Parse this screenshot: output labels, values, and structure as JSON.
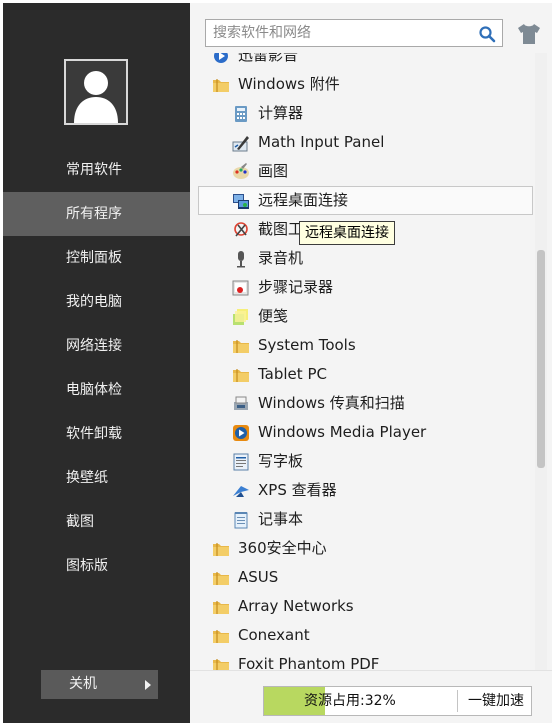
{
  "sidebar": {
    "items": [
      {
        "label": "常用软件"
      },
      {
        "label": "所有程序"
      },
      {
        "label": "控制面板"
      },
      {
        "label": "我的电脑"
      },
      {
        "label": "网络连接"
      },
      {
        "label": "电脑体检"
      },
      {
        "label": "软件卸载"
      },
      {
        "label": "换壁纸"
      },
      {
        "label": "截图"
      },
      {
        "label": "图标版"
      }
    ],
    "active_index": 1,
    "shutdown_label": "关机"
  },
  "search": {
    "placeholder": "搜索软件和网络"
  },
  "programs": [
    {
      "label": "迅雷影音",
      "icon": "media-icon",
      "level": 0
    },
    {
      "label": "Windows 附件",
      "icon": "folder-icon",
      "level": 0
    },
    {
      "label": "计算器",
      "icon": "calculator-icon",
      "level": 1
    },
    {
      "label": "Math Input Panel",
      "icon": "math-pen-icon",
      "level": 1
    },
    {
      "label": "画图",
      "icon": "paint-palette-icon",
      "level": 1
    },
    {
      "label": "远程桌面连接",
      "icon": "remote-desktop-icon",
      "level": 1
    },
    {
      "label": "截图工具",
      "icon": "snipping-tool-icon",
      "level": 1
    },
    {
      "label": "录音机",
      "icon": "microphone-icon",
      "level": 1
    },
    {
      "label": "步骤记录器",
      "icon": "steps-recorder-icon",
      "level": 1
    },
    {
      "label": "便笺",
      "icon": "sticky-notes-icon",
      "level": 1
    },
    {
      "label": "System Tools",
      "icon": "folder-icon",
      "level": 1
    },
    {
      "label": "Tablet PC",
      "icon": "folder-icon",
      "level": 1
    },
    {
      "label": "Windows 传真和扫描",
      "icon": "fax-scanner-icon",
      "level": 1
    },
    {
      "label": "Windows Media Player",
      "icon": "media-player-icon",
      "level": 1
    },
    {
      "label": "写字板",
      "icon": "wordpad-icon",
      "level": 1
    },
    {
      "label": "XPS 查看器",
      "icon": "xps-viewer-icon",
      "level": 1
    },
    {
      "label": "记事本",
      "icon": "notepad-icon",
      "level": 1
    },
    {
      "label": "360安全中心",
      "icon": "folder-icon",
      "level": 0
    },
    {
      "label": "ASUS",
      "icon": "folder-icon",
      "level": 0
    },
    {
      "label": "Array Networks",
      "icon": "folder-icon",
      "level": 0
    },
    {
      "label": "Conexant",
      "icon": "folder-icon",
      "level": 0
    },
    {
      "label": "Foxit Phantom PDF",
      "icon": "folder-icon",
      "level": 0
    }
  ],
  "highlighted_index": 5,
  "tooltip": {
    "text": "远程桌面连接"
  },
  "status": {
    "usage_label": "资源占用:32%",
    "usage_fraction": 0.32,
    "speedup_label": "一键加速"
  },
  "colors": {
    "sidebar_bg": "#2b2b2b",
    "sidebar_active": "#5f5f5f",
    "usage_fill": "#b8d860",
    "folder": "#e8b84a"
  }
}
